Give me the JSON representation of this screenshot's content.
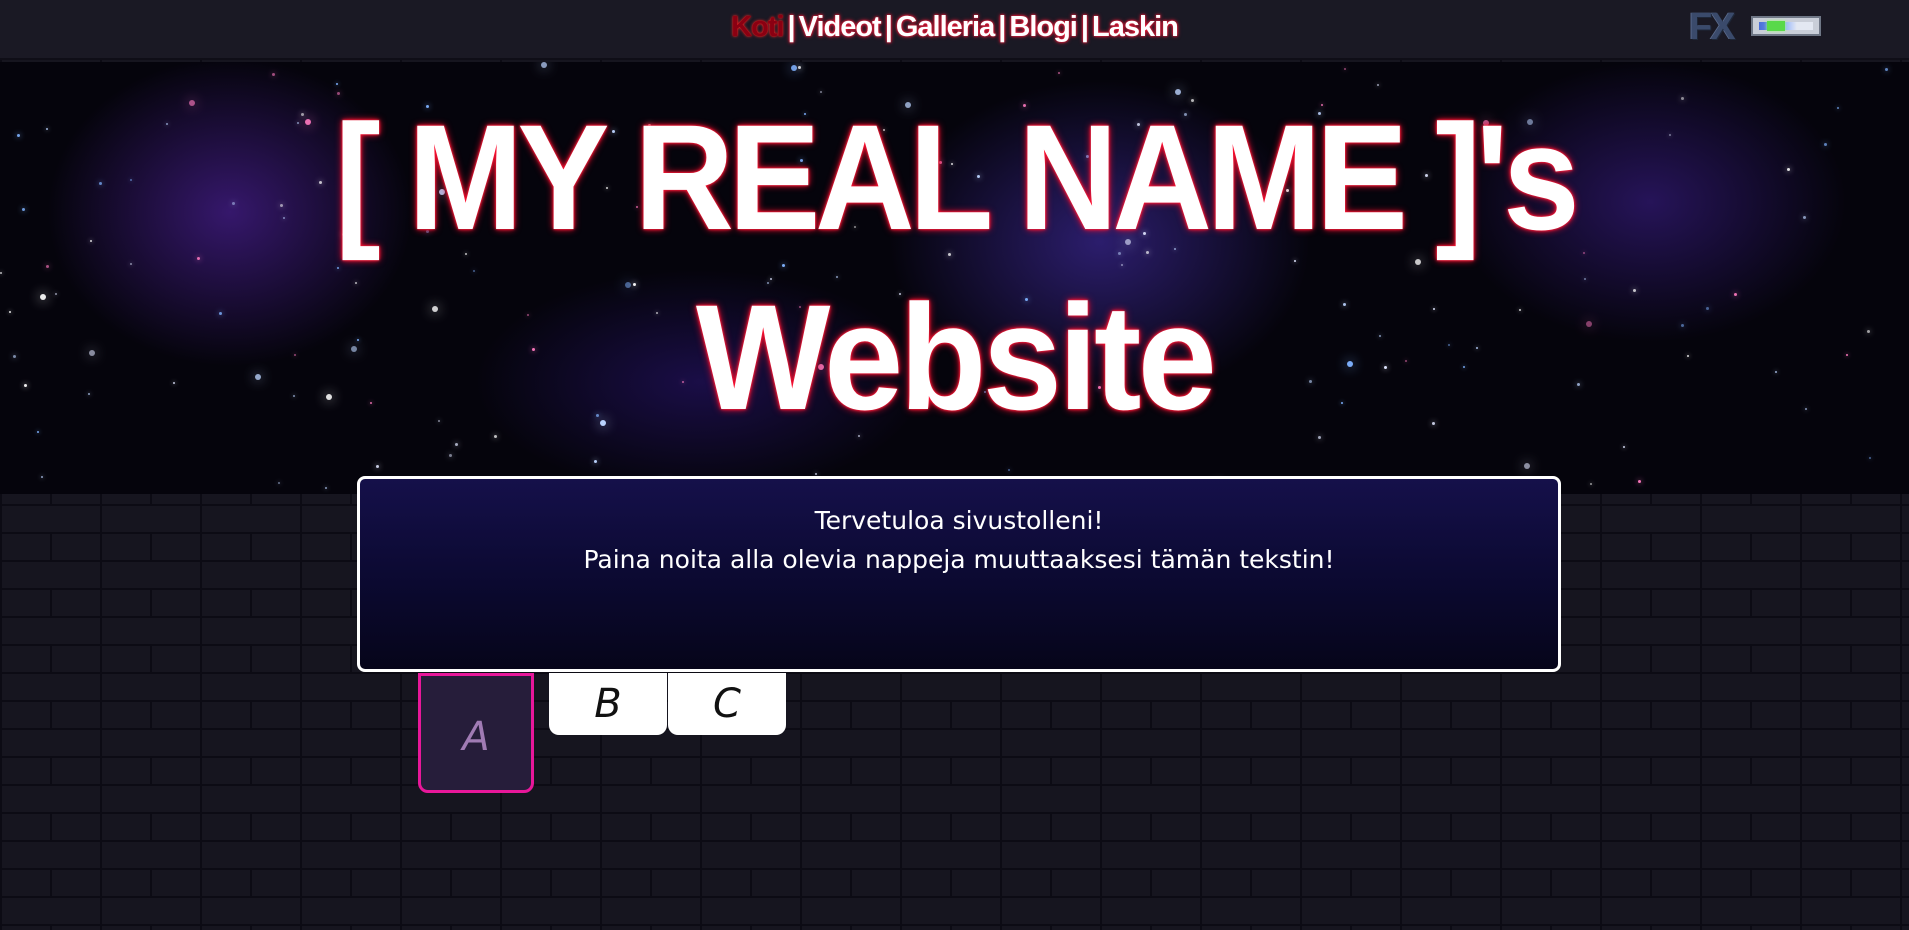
{
  "nav": {
    "items": [
      {
        "label": "Koti",
        "active": true
      },
      {
        "label": "Videot",
        "active": false
      },
      {
        "label": "Galleria",
        "active": false
      },
      {
        "label": "Blogi",
        "active": false
      },
      {
        "label": "Laskin",
        "active": false
      }
    ],
    "separator": "|"
  },
  "fx_toggle": {
    "label": "FX",
    "icon": "toggle-switch-icon"
  },
  "banner": {
    "title_line1": "[ MY REAL NAME ]'s",
    "title_line2": "Website"
  },
  "textbox": {
    "line1": "Tervetuloa sivustolleni!",
    "line2": "Paina noita alla olevia nappeja muuttaaksesi tämän tekstin!"
  },
  "tabs": [
    {
      "label": "A",
      "selected": true
    },
    {
      "label": "B",
      "selected": false
    },
    {
      "label": "C",
      "selected": false
    }
  ],
  "colors": {
    "background": "#16151f",
    "title_glow": "#ff1030",
    "active_tab_border": "#e8179a",
    "active_nav": "#8a0012",
    "textbox_border": "#ffffff"
  }
}
